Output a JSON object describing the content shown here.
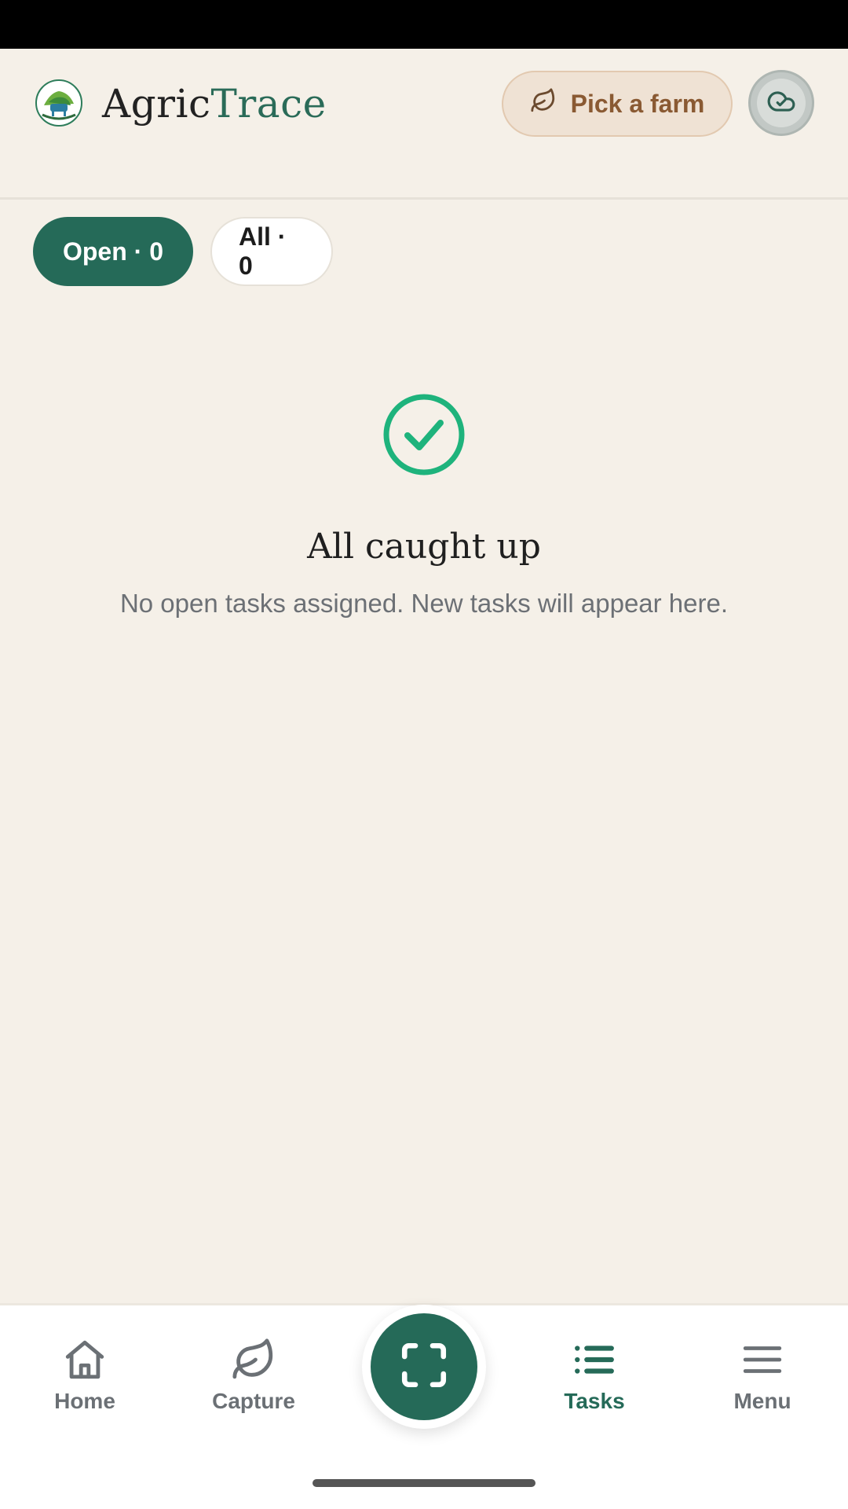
{
  "app": {
    "brand_part1": "Agric",
    "brand_part2": "Trace",
    "accent_color": "#256a58",
    "background_color": "#f5f0e8"
  },
  "header": {
    "farm_button_label": "Pick a farm",
    "farm_icon": "leaf-icon",
    "sync_icon": "cloud-check-icon"
  },
  "tabs": [
    {
      "label": "Open · 0",
      "active": true
    },
    {
      "label": "All · 0",
      "active": false
    }
  ],
  "empty_state": {
    "icon": "check-circle-icon",
    "title": "All caught up",
    "subtitle": "No open tasks assigned. New tasks will appear here."
  },
  "bottom_nav": {
    "items": [
      {
        "label": "Home",
        "icon": "home-icon",
        "active": false
      },
      {
        "label": "Capture",
        "icon": "leaf-icon",
        "active": false
      },
      {
        "label": "Tasks",
        "icon": "list-icon",
        "active": true
      },
      {
        "label": "Menu",
        "icon": "menu-icon",
        "active": false
      }
    ],
    "center_action_icon": "scan-icon"
  }
}
